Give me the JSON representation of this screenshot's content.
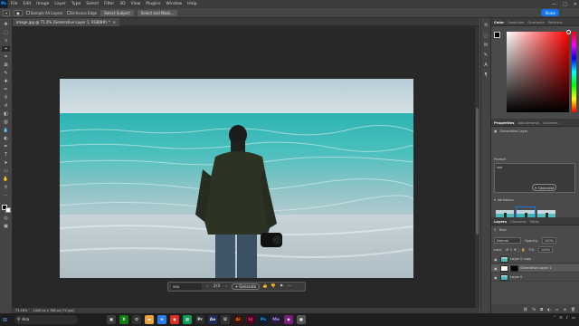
{
  "menubar": {
    "logo": "Ps",
    "items": [
      "File",
      "Edit",
      "Image",
      "Layer",
      "Type",
      "Select",
      "Filter",
      "3D",
      "View",
      "Plugins",
      "Window",
      "Help"
    ],
    "window_controls": [
      "—",
      "□",
      "✕"
    ]
  },
  "options_bar": {
    "checkbox1": "Sample All Layers",
    "checkbox2": "Enhance Edge",
    "button1": "Select Subject",
    "button2": "Select and Mask...",
    "share_label": "Share"
  },
  "document": {
    "tab_title": "image.jpg @ 71.2% (Generative Layer 1, RGB/8#) *",
    "tab_close": "×"
  },
  "status_bar": {
    "zoom": "71.16%",
    "doc_size": "1400 px x 788 px (72 ppi)"
  },
  "contextual_bar": {
    "prompt_placeholder": "sea",
    "pager": "2/3",
    "generate_label": "Generate"
  },
  "color_panel": {
    "tabs": [
      "Color",
      "Swatches",
      "Gradients",
      "Patterns"
    ],
    "active_tab": "Color",
    "fg_color": "#000000",
    "bg_color": "#ffffff"
  },
  "properties_panel": {
    "tabs": [
      "Properties",
      "Adjustments",
      "Libraries"
    ],
    "active_tab": "Properties",
    "layer_type": "Generative Layer",
    "prompt_label": "Prompt",
    "prompt_value": "sea",
    "generate_label": "Generate",
    "variations_label": "Variations"
  },
  "layers_panel": {
    "tabs": [
      "Layers",
      "Channels",
      "Paths"
    ],
    "active_tab": "Layers",
    "kind_label": "Kind",
    "blend_mode": "Normal",
    "opacity_label": "Opacity:",
    "opacity_value": "100%",
    "lock_label": "Lock:",
    "fill_label": "Fill:",
    "fill_value": "100%",
    "layers": [
      {
        "name": "Layer 0 copy",
        "selected": false
      },
      {
        "name": "Generative Layer 1",
        "selected": true
      },
      {
        "name": "Layer 0",
        "selected": false
      }
    ]
  },
  "taskbar": {
    "search_label": "Ara",
    "tray_time": ""
  }
}
